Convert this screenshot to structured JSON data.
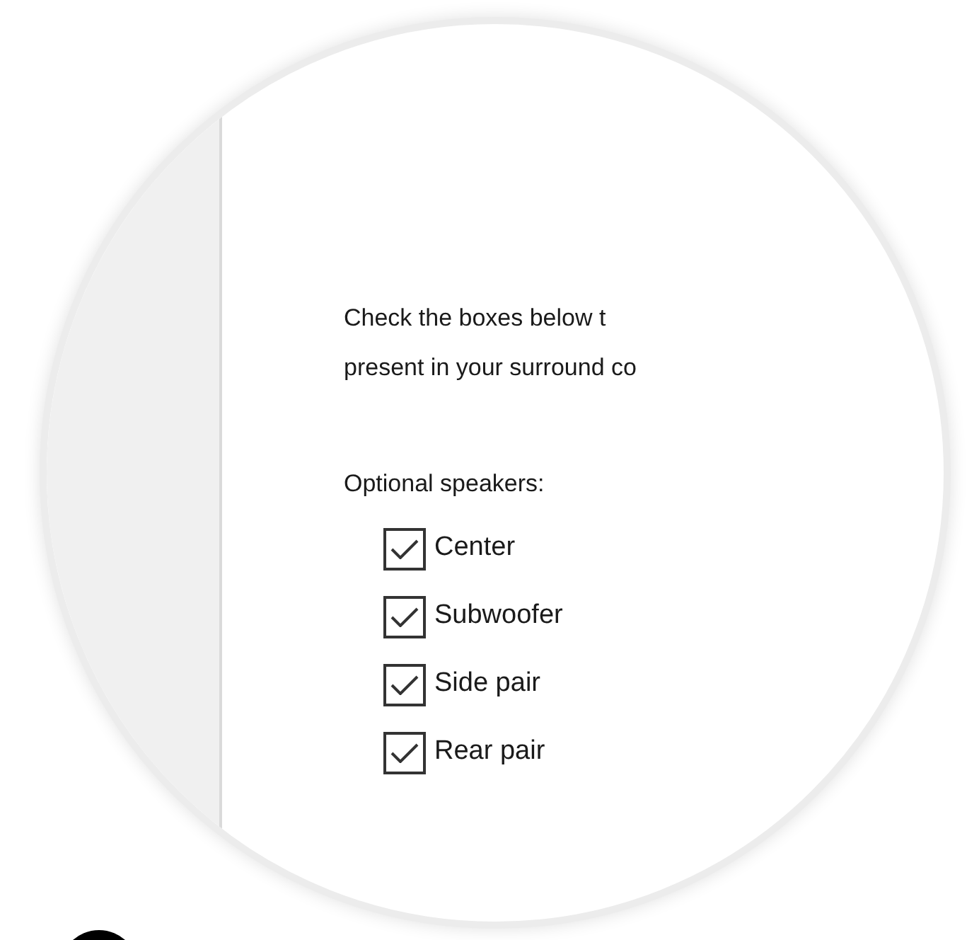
{
  "instructions": [
    "Check the boxes below t",
    "present in your surround co"
  ],
  "section_label": "Optional speakers:",
  "speakers": [
    {
      "label": "Center",
      "checked": true
    },
    {
      "label": "Subwoofer",
      "checked": true
    },
    {
      "label": "Side pair",
      "checked": true
    },
    {
      "label": "Rear pair",
      "checked": true
    }
  ]
}
